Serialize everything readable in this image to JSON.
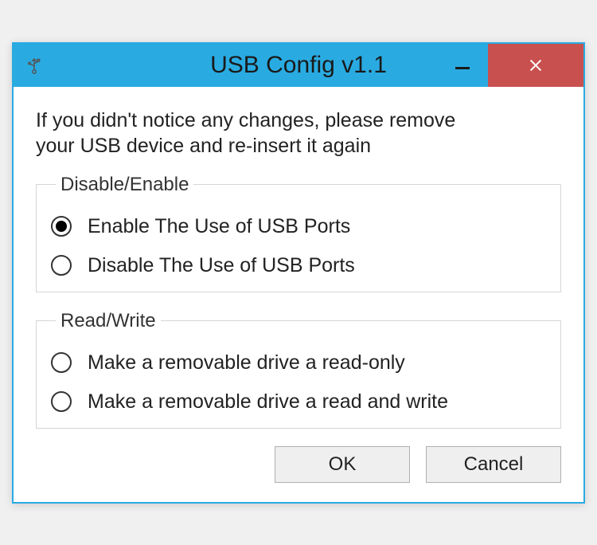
{
  "window": {
    "title": "USB Config v1.1"
  },
  "content": {
    "intro_line1": "If you didn't notice any changes, please remove",
    "intro_line2": "your USB device and re-insert it again"
  },
  "group1": {
    "legend": "Disable/Enable",
    "options": [
      {
        "label": "Enable The Use of USB Ports",
        "checked": true
      },
      {
        "label": "Disable The Use of USB Ports",
        "checked": false
      }
    ]
  },
  "group2": {
    "legend": "Read/Write",
    "options": [
      {
        "label": "Make a removable drive a read-only",
        "checked": false
      },
      {
        "label": "Make a removable drive a read and write",
        "checked": false
      }
    ]
  },
  "buttons": {
    "ok": "OK",
    "cancel": "Cancel"
  }
}
